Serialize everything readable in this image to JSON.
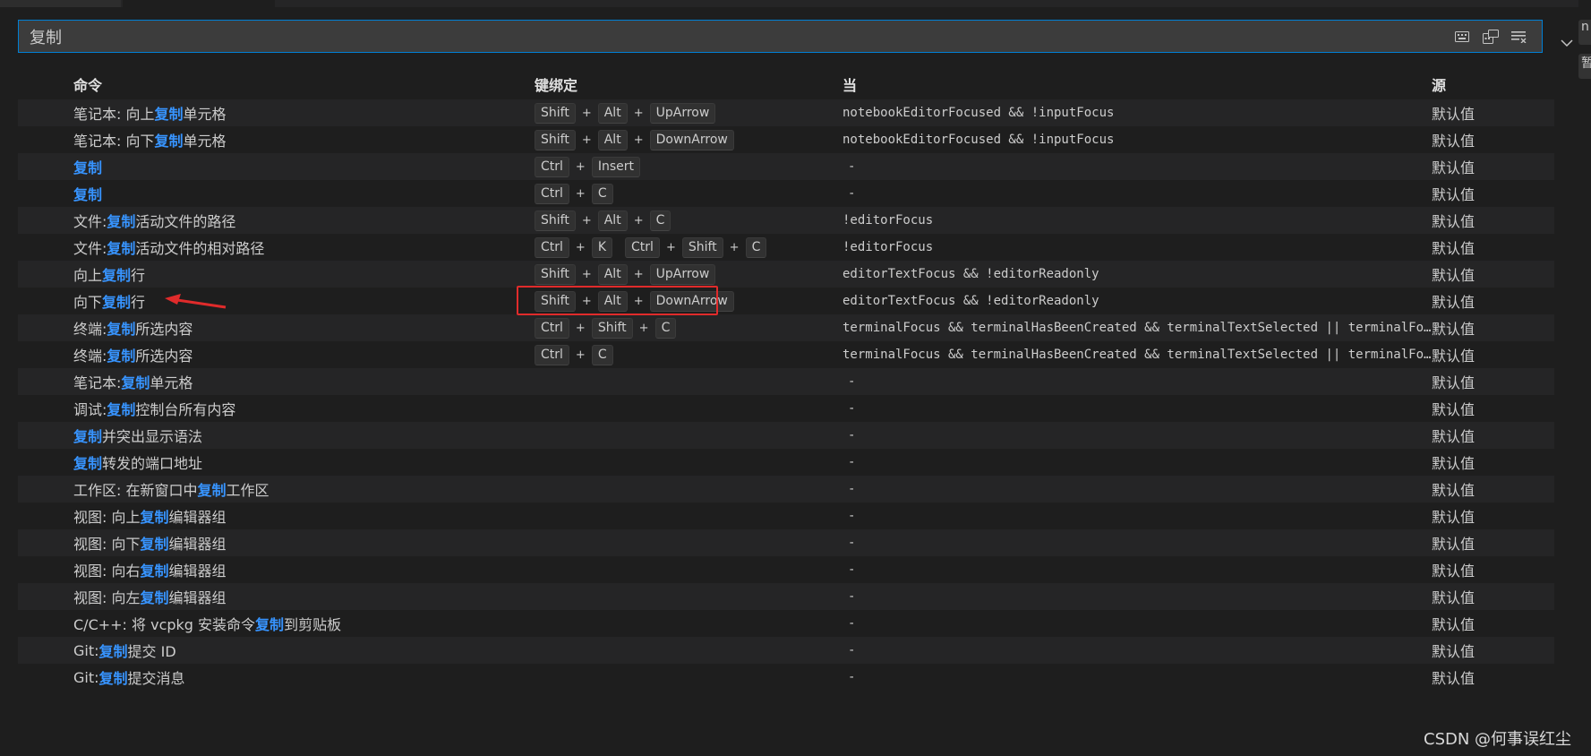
{
  "search": {
    "value": "复制"
  },
  "rail": {
    "chip1": "n",
    "chip2": "暂"
  },
  "columns": {
    "command": "命令",
    "keybinding": "键绑定",
    "when": "当",
    "source": "源"
  },
  "rows": [
    {
      "cmd": [
        {
          "t": "笔记本: 向上"
        },
        {
          "t": "复制",
          "h": true
        },
        {
          "t": "单元格"
        }
      ],
      "keys": [
        [
          "Shift",
          "Alt",
          "UpArrow"
        ]
      ],
      "when": "notebookEditorFocused && !inputFocus",
      "source": "默认值"
    },
    {
      "cmd": [
        {
          "t": "笔记本: 向下"
        },
        {
          "t": "复制",
          "h": true
        },
        {
          "t": "单元格"
        }
      ],
      "keys": [
        [
          "Shift",
          "Alt",
          "DownArrow"
        ]
      ],
      "when": "notebookEditorFocused && !inputFocus",
      "source": "默认值"
    },
    {
      "cmd": [
        {
          "t": "复制",
          "h": true
        }
      ],
      "keys": [
        [
          "Ctrl",
          "Insert"
        ]
      ],
      "when": "-",
      "source": "默认值"
    },
    {
      "cmd": [
        {
          "t": "复制",
          "h": true
        }
      ],
      "keys": [
        [
          "Ctrl",
          "C"
        ]
      ],
      "when": "-",
      "source": "默认值"
    },
    {
      "cmd": [
        {
          "t": "文件: "
        },
        {
          "t": "复制",
          "h": true
        },
        {
          "t": "活动文件的路径"
        }
      ],
      "keys": [
        [
          "Shift",
          "Alt",
          "C"
        ]
      ],
      "when": "!editorFocus",
      "source": "默认值"
    },
    {
      "cmd": [
        {
          "t": "文件: "
        },
        {
          "t": "复制",
          "h": true
        },
        {
          "t": "活动文件的相对路径"
        }
      ],
      "keys": [
        [
          "Ctrl",
          "K"
        ],
        [
          "Ctrl",
          "Shift",
          "C"
        ]
      ],
      "when": "!editorFocus",
      "source": "默认值"
    },
    {
      "cmd": [
        {
          "t": "向上"
        },
        {
          "t": "复制",
          "h": true
        },
        {
          "t": "行"
        }
      ],
      "keys": [
        [
          "Shift",
          "Alt",
          "UpArrow"
        ]
      ],
      "when": "editorTextFocus && !editorReadonly",
      "source": "默认值"
    },
    {
      "cmd": [
        {
          "t": "向下"
        },
        {
          "t": "复制",
          "h": true
        },
        {
          "t": "行"
        }
      ],
      "keys": [
        [
          "Shift",
          "Alt",
          "DownArrow"
        ]
      ],
      "when": "editorTextFocus && !editorReadonly",
      "source": "默认值"
    },
    {
      "cmd": [
        {
          "t": "终端: "
        },
        {
          "t": "复制",
          "h": true
        },
        {
          "t": "所选内容"
        }
      ],
      "keys": [
        [
          "Ctrl",
          "Shift",
          "C"
        ]
      ],
      "when": "terminalFocus && terminalHasBeenCreated && terminalTextSelected || terminalFocu…",
      "source": "默认值"
    },
    {
      "cmd": [
        {
          "t": "终端: "
        },
        {
          "t": "复制",
          "h": true
        },
        {
          "t": "所选内容"
        }
      ],
      "keys": [
        [
          "Ctrl",
          "C"
        ]
      ],
      "when": "terminalFocus && terminalHasBeenCreated && terminalTextSelected || terminalFocu…",
      "source": "默认值"
    },
    {
      "cmd": [
        {
          "t": "笔记本: "
        },
        {
          "t": "复制",
          "h": true
        },
        {
          "t": "单元格"
        }
      ],
      "keys": [],
      "when": "-",
      "source": "默认值"
    },
    {
      "cmd": [
        {
          "t": "调试: "
        },
        {
          "t": "复制",
          "h": true
        },
        {
          "t": "控制台所有内容"
        }
      ],
      "keys": [],
      "when": "-",
      "source": "默认值"
    },
    {
      "cmd": [
        {
          "t": "复制",
          "h": true
        },
        {
          "t": "并突出显示语法"
        }
      ],
      "keys": [],
      "when": "-",
      "source": "默认值"
    },
    {
      "cmd": [
        {
          "t": "复制",
          "h": true
        },
        {
          "t": "转发的端口地址"
        }
      ],
      "keys": [],
      "when": "-",
      "source": "默认值"
    },
    {
      "cmd": [
        {
          "t": "工作区: 在新窗口中"
        },
        {
          "t": "复制",
          "h": true
        },
        {
          "t": "工作区"
        }
      ],
      "keys": [],
      "when": "-",
      "source": "默认值"
    },
    {
      "cmd": [
        {
          "t": "视图: 向上"
        },
        {
          "t": "复制",
          "h": true
        },
        {
          "t": "编辑器组"
        }
      ],
      "keys": [],
      "when": "-",
      "source": "默认值"
    },
    {
      "cmd": [
        {
          "t": "视图: 向下"
        },
        {
          "t": "复制",
          "h": true
        },
        {
          "t": "编辑器组"
        }
      ],
      "keys": [],
      "when": "-",
      "source": "默认值"
    },
    {
      "cmd": [
        {
          "t": "视图: 向右"
        },
        {
          "t": "复制",
          "h": true
        },
        {
          "t": "编辑器组"
        }
      ],
      "keys": [],
      "when": "-",
      "source": "默认值"
    },
    {
      "cmd": [
        {
          "t": "视图: 向左"
        },
        {
          "t": "复制",
          "h": true
        },
        {
          "t": "编辑器组"
        }
      ],
      "keys": [],
      "when": "-",
      "source": "默认值"
    },
    {
      "cmd": [
        {
          "t": "C/C++: 将 vcpkg 安装命令"
        },
        {
          "t": "复制",
          "h": true
        },
        {
          "t": "到剪贴板"
        }
      ],
      "keys": [],
      "when": "-",
      "source": "默认值"
    },
    {
      "cmd": [
        {
          "t": "Git: "
        },
        {
          "t": "复制",
          "h": true
        },
        {
          "t": "提交 ID"
        }
      ],
      "keys": [],
      "when": "-",
      "source": "默认值"
    },
    {
      "cmd": [
        {
          "t": "Git: "
        },
        {
          "t": "复制",
          "h": true
        },
        {
          "t": "提交消息"
        }
      ],
      "keys": [],
      "when": "-",
      "source": "默认值"
    }
  ],
  "watermark": "CSDN @何事误红尘",
  "colors": {
    "highlight": "#3794ff",
    "focus_border": "#007fd4",
    "annotation_red": "#e02b2b"
  },
  "icons": {
    "search_actions": [
      "keyboard-icon",
      "record-keys-icon",
      "clear-filter-icon"
    ],
    "collapse": "chevron-down-icon"
  }
}
